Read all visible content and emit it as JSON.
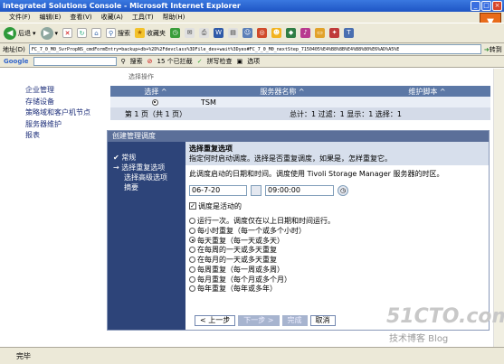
{
  "window": {
    "title": "Integrated Solutions Console - Microsoft Internet Explorer"
  },
  "menu": [
    "文件(F)",
    "编辑(E)",
    "查看(V)",
    "收藏(A)",
    "工具(T)",
    "帮助(H)"
  ],
  "toolbar": {
    "back": "后退",
    "search": "搜索",
    "favorites": "收藏夹"
  },
  "address": {
    "label": "地址(D)",
    "url": "FC_7_0_M0_SvrPropNS_cmdFormEntry=backup+db+%2D%2Fdevclass%3DFile_dev+wait%3Dyes#FC_7_0_M0_nextStep_7150405%E4%B8%8B%E4%B8%80%E6%AD%A5%E",
    "go": "转到"
  },
  "googlebar": {
    "logo": "Google",
    "search": "搜索",
    "blocked": "15 个已拦截",
    "spell": "拼写检查",
    "options": "选项"
  },
  "leftnav": [
    "企业管理",
    "存储设备",
    "策略域和客户机节点",
    "服务器维护",
    "报表"
  ],
  "table": {
    "hint": "选择操作",
    "headers": [
      "选择 ^",
      "服务器名称 ^",
      "维护脚本 ^"
    ],
    "row": {
      "name": "TSM"
    },
    "footer_page": "第 1 页（共 1 页）",
    "footer_stats": "总计：1  过滤：1  显示：1  选择：1"
  },
  "wizard": {
    "title": "创建管理调度",
    "steps": [
      "常规",
      "选择重复选项",
      "选择高级选项",
      "摘要"
    ],
    "section_title": "选择重复选项",
    "section_desc": "指定何时启动调度。选择是否重复调度，如果是，怎样重复它。",
    "intro": "此调度启动的日期和时间。调度使用 Tivoli Storage Manager 服务器的时区。",
    "date": "06-7-20",
    "time": "09:00:00",
    "active_label": "调度是活动的",
    "options": [
      "运行一次。调度仅在以上日期和时间运行。",
      "每小时重复（每一个或多个小时）",
      "每天重复（每一天或多天）",
      "在每周的一天或多天重复",
      "在每月的一天或多天重复",
      "每周重复（每一周或多周）",
      "每月重复（每个月或多个月）",
      "每年重复（每年或多年）"
    ],
    "selected_index": 2,
    "buttons": {
      "prev": "< 上一步",
      "next": "下一步 >",
      "finish": "完成",
      "cancel": "取消"
    }
  },
  "statusbar": {
    "text": "完毕"
  },
  "watermark": {
    "main": "51CTO.com",
    "sub": "技术博客  Blog"
  }
}
